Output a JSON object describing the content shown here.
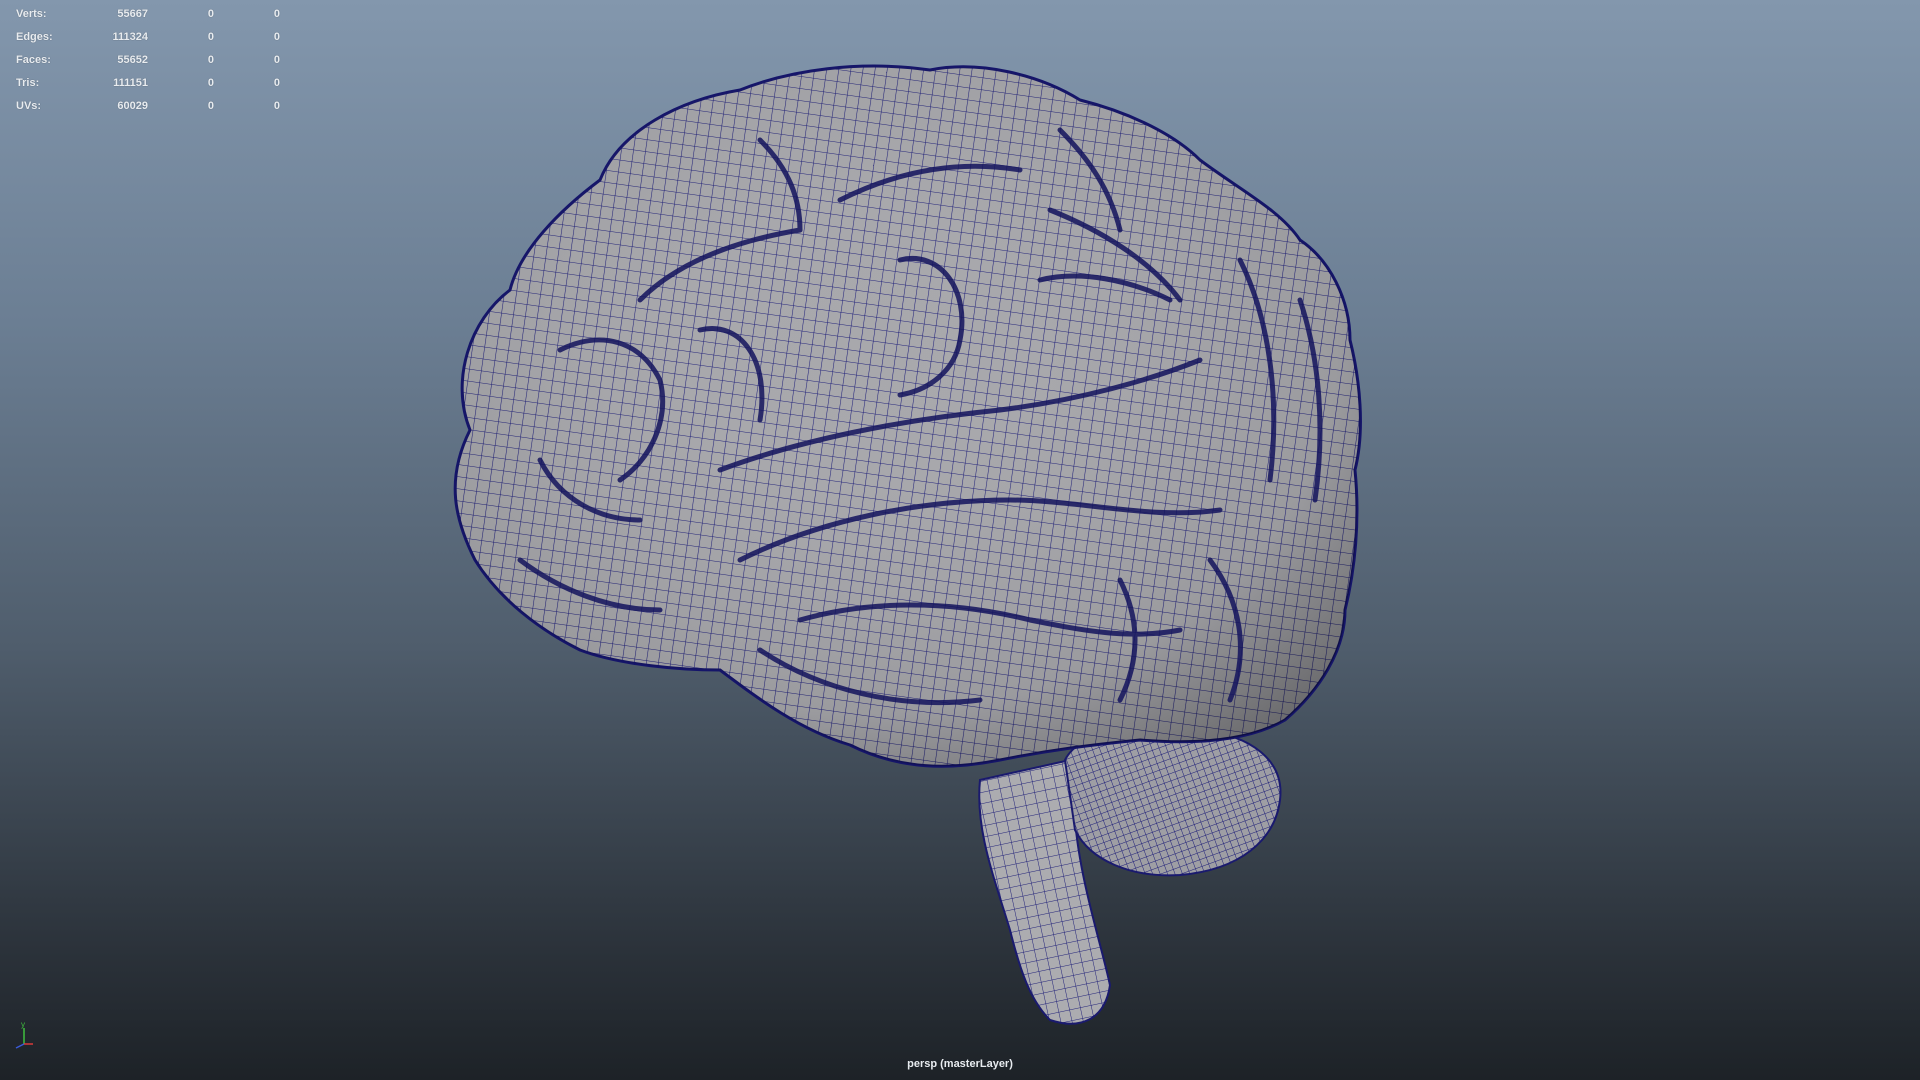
{
  "viewport": {
    "camera_label": "persp (masterLayer)",
    "background_top": "#8397ad",
    "background_bottom": "#1d2227",
    "mesh_fill": "#a9a9ad",
    "wire_color": "#1a1a7a"
  },
  "hud": {
    "rows": [
      {
        "label": "Verts:",
        "value": "55667",
        "selected": "0",
        "component": "0"
      },
      {
        "label": "Edges:",
        "value": "111324",
        "selected": "0",
        "component": "0"
      },
      {
        "label": "Faces:",
        "value": "55652",
        "selected": "0",
        "component": "0"
      },
      {
        "label": "Tris:",
        "value": "111151",
        "selected": "0",
        "component": "0"
      },
      {
        "label": "UVs:",
        "value": "60029",
        "selected": "0",
        "component": "0"
      }
    ]
  },
  "axis": {
    "y_label": "y",
    "icon": "axis-gizmo-icon"
  }
}
